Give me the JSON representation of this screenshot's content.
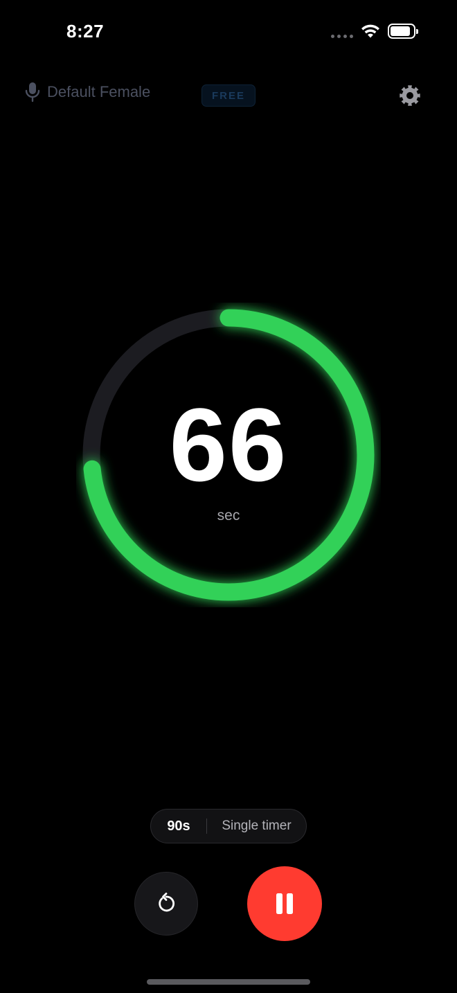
{
  "status_bar": {
    "time": "8:27",
    "battery_level": 0.9
  },
  "header": {
    "voice_label": "Default Female",
    "badge": "FREE",
    "icons": {
      "voice": "microphone-icon",
      "settings": "gear-icon"
    }
  },
  "timer": {
    "value": "66",
    "unit": "sec",
    "total_seconds": 90,
    "remaining_seconds": 66,
    "progress_color": "#30d158",
    "track_color": "#1c1c21"
  },
  "info_pill": {
    "duration": "90s",
    "mode": "Single timer"
  },
  "controls": {
    "reset_icon": "reset-icon",
    "pause_icon": "pause-icon",
    "pause_color": "#ff3b30"
  }
}
